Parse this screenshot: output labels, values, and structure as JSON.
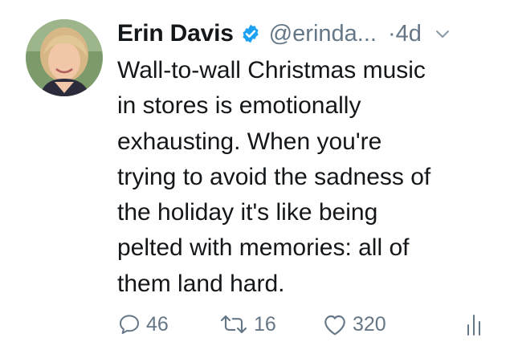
{
  "tweet": {
    "display_name": "Erin Davis",
    "handle": "@erinda...",
    "time": "·4d",
    "text": "Wall-to-wall Christmas music\nin stores is emotionally\nexhausting. When you're\ntrying to avoid the sadness of\nthe holiday it's like being\npelted with memories: all of\nthem land hard.",
    "verified": true,
    "counts": {
      "replies": "46",
      "retweets": "16",
      "likes": "320"
    }
  },
  "icons": {
    "verified": "verified-badge-icon",
    "caret": "chevron-down-icon",
    "reply": "reply-icon",
    "retweet": "retweet-icon",
    "like": "heart-icon",
    "analytics": "analytics-icon"
  },
  "colors": {
    "verified_blue": "#1da1f2",
    "muted_text": "#657786",
    "primary_text": "#14171a"
  }
}
